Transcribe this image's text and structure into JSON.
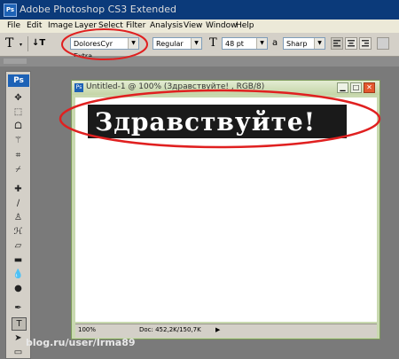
{
  "app": {
    "title": "Adobe Photoshop CS3 Extended",
    "logo": "Ps"
  },
  "menu": [
    "File",
    "Edit",
    "Image",
    "Layer",
    "Select",
    "Filter",
    "Analysis",
    "View",
    "Window",
    "Help"
  ],
  "options": {
    "font_family": "DoloresCyr Extra...",
    "font_style": "Regular",
    "font_size": "48 pt",
    "aa_label": "a",
    "antialias": "Sharp"
  },
  "document": {
    "title": "Untitled-1 @ 100% (Здравствуйте! , RGB/8)",
    "text": "Здравствуйте!",
    "zoom": "100%",
    "doc_info": "Doc: 452,2K/150,7K"
  },
  "watermark": {
    "site": "blog.ru/user/Irma89"
  },
  "colors": {
    "titlebar": "#0b3a7a",
    "annotation": "#e02020",
    "doc_frame": "#c9d9b0"
  }
}
